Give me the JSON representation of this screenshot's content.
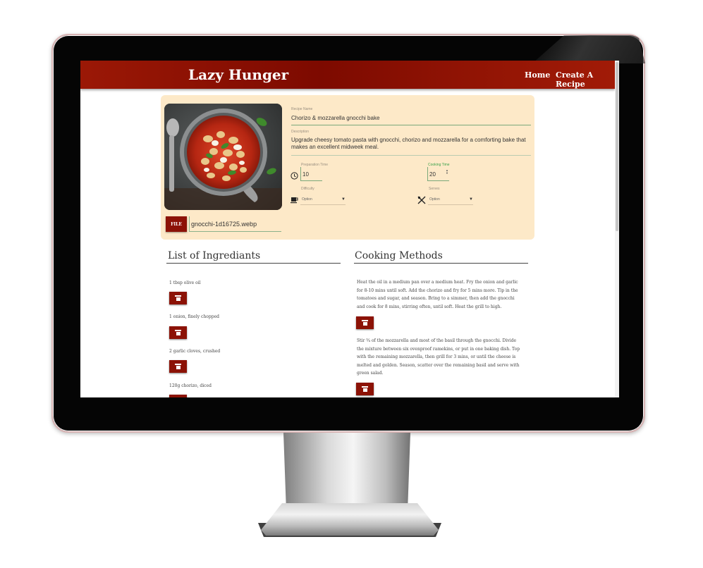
{
  "app": {
    "brand": "Lazy Hunger",
    "nav": {
      "home": "Home",
      "create": "Create A Recipe"
    }
  },
  "recipe": {
    "name_label": "Recipe Name",
    "name": "Chorizo & mozzarella gnocchi bake",
    "description_label": "Description",
    "description": "Upgrade cheesy tomato pasta with gnocchi, chorizo and mozzarella for a comforting bake that makes an excellent midweek meal.",
    "prep_label": "Preparation Time",
    "prep_time": "10",
    "cook_label": "Cooking Time",
    "cook_time": "20",
    "difficulty_label": "Difficulty",
    "difficulty_value": "Option",
    "serves_label": "Serves",
    "serves_value": "Option",
    "file_button": "FILE",
    "file_name": "gnocchi-1d16725.webp"
  },
  "ingredients": {
    "title": "List of Ingrediants",
    "items": [
      "1 tbsp olive oil",
      "1 onion, finely chopped",
      "2 garlic cloves, crushed",
      "120g chorizo, diced"
    ]
  },
  "methods": {
    "title": "Cooking Methods",
    "steps": [
      "Heat the oil in a medium pan over a medium heat. Fry the onion and garlic for 8-10 mins until soft. Add the chorizo and fry for 5 mins more. Tip in the tomatoes and sugar, and season. Bring to a simmer, then add the gnocchi and cook for 8 mins, stirring often, until soft. Heat the grill to high.",
      "Stir ¾ of the mozzarella and most of the basil through the gnocchi. Divide the mixture between six ovenproof ramekins, or put in one baking dish. Top with the remaining mozzarella, then grill for 3 mins, or until the cheese is melted and golden. Season, scatter over the remaining basil and serve with green salad."
    ]
  },
  "colors": {
    "navbar": "#8a0f02",
    "card": "#fde9c8",
    "button": "#8c1206"
  },
  "icons": {
    "prep": "clock-icon",
    "difficulty": "cup-icon",
    "serves": "cutlery-icon",
    "delete": "trash-icon"
  }
}
